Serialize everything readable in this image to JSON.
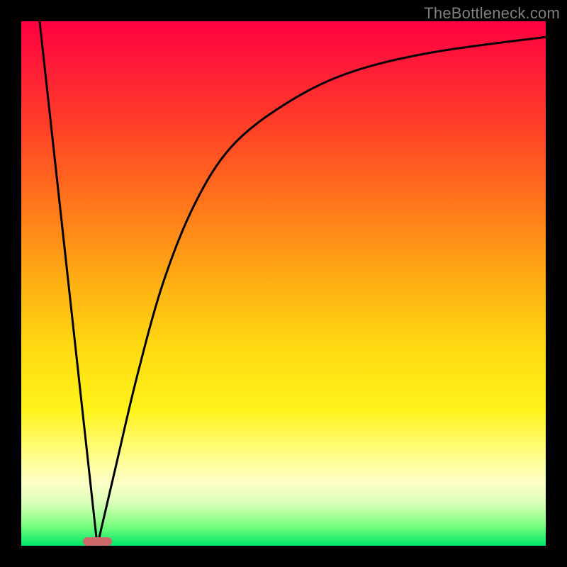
{
  "watermark": "TheBottleneck.com",
  "chart_data": {
    "type": "line",
    "title": "",
    "xlabel": "",
    "ylabel": "",
    "xlim": [
      0,
      100
    ],
    "ylim": [
      0,
      100
    ],
    "background_gradient": {
      "direction": "vertical",
      "stops": [
        {
          "pos": 0.0,
          "color": "#ff0040",
          "meaning": "worst"
        },
        {
          "pos": 0.5,
          "color": "#ffb014"
        },
        {
          "pos": 0.74,
          "color": "#fff31a"
        },
        {
          "pos": 1.0,
          "color": "#00e86a",
          "meaning": "best"
        }
      ]
    },
    "series": [
      {
        "name": "bottleneck-curve",
        "type": "line",
        "color": "#000000",
        "points": [
          {
            "x": 3.5,
            "y": 100
          },
          {
            "x": 14.5,
            "y": 0
          },
          {
            "x": 18,
            "y": 15
          },
          {
            "x": 22,
            "y": 32
          },
          {
            "x": 27,
            "y": 50
          },
          {
            "x": 33,
            "y": 65
          },
          {
            "x": 40,
            "y": 76
          },
          {
            "x": 50,
            "y": 84
          },
          {
            "x": 62,
            "y": 90
          },
          {
            "x": 78,
            "y": 94
          },
          {
            "x": 100,
            "y": 97
          }
        ]
      }
    ],
    "marker": {
      "shape": "rounded-rect",
      "color": "#cc6a6a",
      "x": 14.5,
      "y": 0,
      "width_pct": 5.5,
      "height_pct": 1.6
    }
  },
  "css_vars": {
    "marker_left_pct": 11.8,
    "marker_bottom_pct": 0,
    "marker_width_pct": 5.5,
    "marker_height_pct": 1.6
  }
}
